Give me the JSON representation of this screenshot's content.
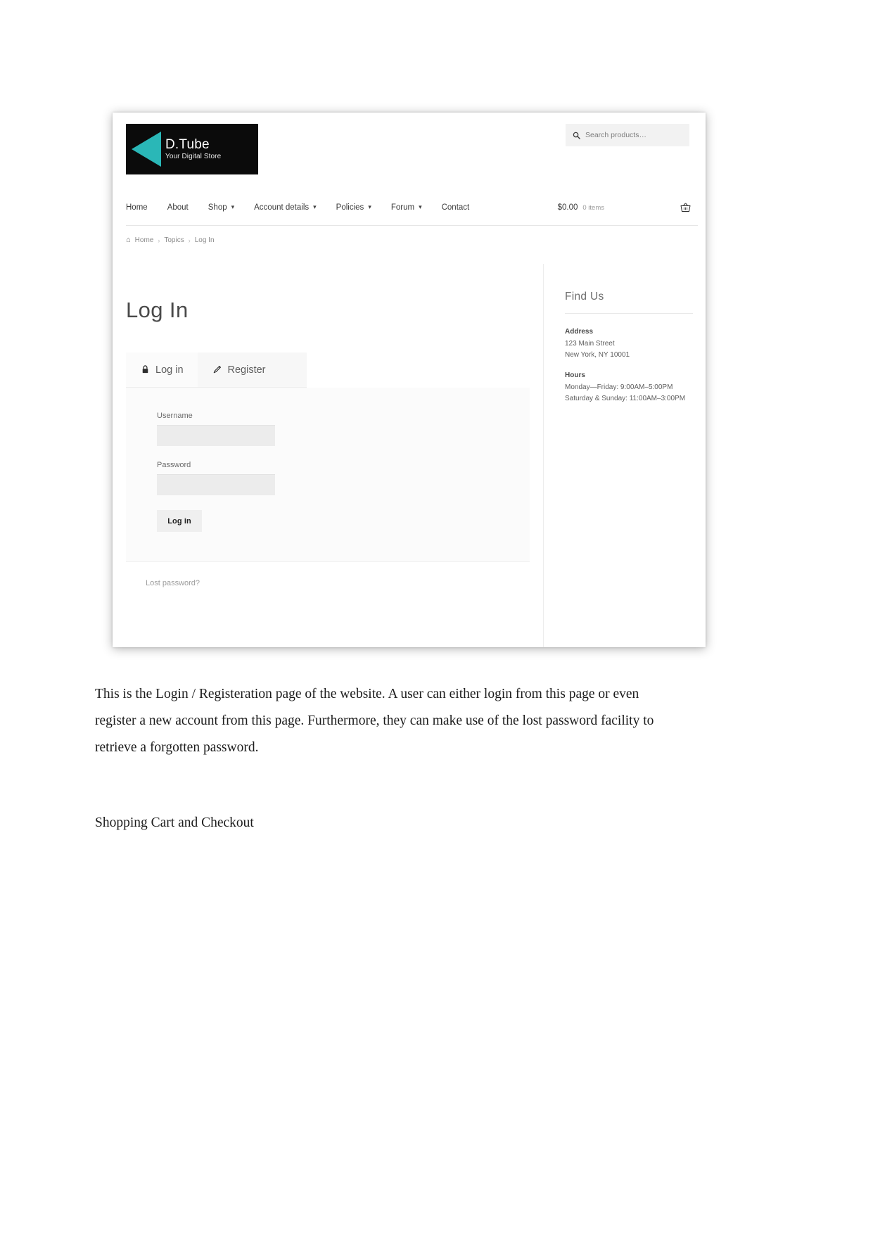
{
  "site": {
    "logo": {
      "title": "D.Tube",
      "tagline": "Your Digital Store",
      "triangle_color": "#2ab7b7",
      "background_color": "#0b0b0b"
    },
    "search": {
      "icon": "search-icon",
      "placeholder": "Search products…",
      "value": ""
    },
    "nav": [
      {
        "label": "Home",
        "has_dropdown": false
      },
      {
        "label": "About",
        "has_dropdown": false
      },
      {
        "label": "Shop",
        "has_dropdown": true
      },
      {
        "label": "Account details",
        "has_dropdown": true
      },
      {
        "label": "Policies",
        "has_dropdown": true
      },
      {
        "label": "Forum",
        "has_dropdown": true
      },
      {
        "label": "Contact",
        "has_dropdown": false
      }
    ],
    "cart": {
      "total": "$0.00",
      "count": "0 items",
      "icon": "shopping-basket-icon"
    },
    "breadcrumb": {
      "home_icon": "home-icon",
      "items": [
        "Home",
        "Topics",
        "Log In"
      ],
      "separator": "›"
    }
  },
  "main": {
    "page_title": "Log In",
    "tabs": [
      {
        "label": "Log in",
        "icon": "lock-icon",
        "active": true
      },
      {
        "label": "Register",
        "icon": "pencil-icon",
        "active": false
      }
    ],
    "form": {
      "username_label": "Username",
      "username_value": "",
      "password_label": "Password",
      "password_value": "",
      "submit_label": "Log in"
    },
    "lost_password_label": "Lost password?"
  },
  "sidebar": {
    "widget_title": "Find Us",
    "address_heading": "Address",
    "address_lines": [
      "123 Main Street",
      "New York, NY 10001"
    ],
    "hours_heading": "Hours",
    "hours_lines": [
      "Monday—Friday: 9:00AM–5:00PM",
      "Saturday & Sunday: 11:00AM–3:00PM"
    ]
  },
  "document": {
    "paragraph": "This is the Login / Registeration page of the website. A user can either login from this page or even register a new account from this page. Furthermore, they can make use of the lost password facility to retrieve a forgotten password.",
    "heading": "Shopping Cart and Checkout"
  }
}
